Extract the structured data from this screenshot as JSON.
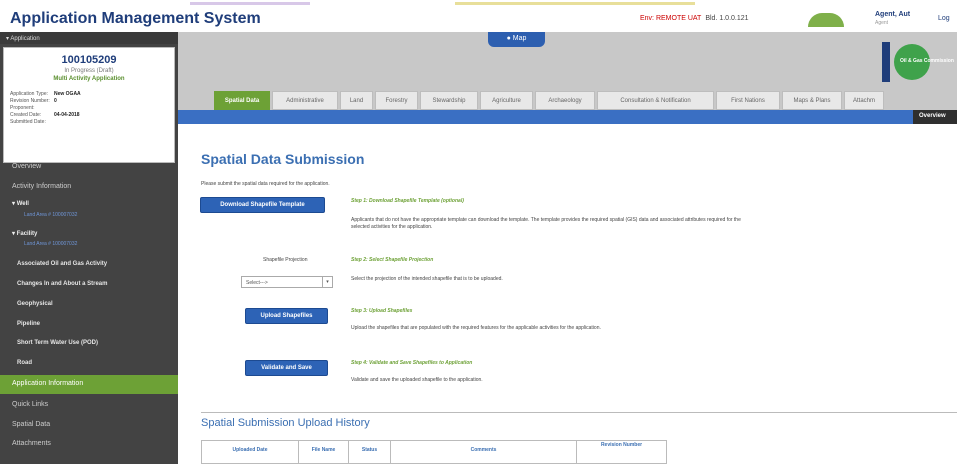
{
  "header": {
    "app_title": "Application Management System",
    "env_label": "Env: REMOTE UAT",
    "env_version": "Bld. 1.0.0.121",
    "agent_name": "Agent, Aut",
    "agent_sub": "Agent",
    "logout_label": "Log"
  },
  "sidebar": {
    "section_label": "Application",
    "app_number": "100105209",
    "app_status": "In Progress (Draft)",
    "app_type_label": "Multi Activity Application",
    "details": [
      {
        "key": "Application Type:",
        "value": "New OGAA"
      },
      {
        "key": "Revision Number:",
        "value": "0"
      },
      {
        "key": "Proponent:",
        "value": ""
      },
      {
        "key": "Created Date:",
        "value": "04-04-2018"
      },
      {
        "key": "Submitted Date:",
        "value": ""
      }
    ],
    "overview": "Overview",
    "activity_information": "Activity Information",
    "well_group": "Well",
    "well_land": "Land Area # 100007032",
    "facility_group": "Facility",
    "facility_land": "Land Area # 100007032",
    "items": [
      "Associated Oil and Gas Activity",
      "Changes In and About a Stream",
      "Geophysical",
      "Pipeline",
      "Short Term Water Use (POD)",
      "Road"
    ],
    "application_information": "Application Information",
    "quick_links": "Quick Links",
    "spatial_data": "Spatial Data",
    "attachments": "Attachments"
  },
  "map_button": "Map",
  "tabs": [
    {
      "label": "Spatial Data",
      "active": true
    },
    {
      "label": "Administrative",
      "active": false
    },
    {
      "label": "Land",
      "active": false
    },
    {
      "label": "Forestry",
      "active": false
    },
    {
      "label": "Stewardship",
      "active": false
    },
    {
      "label": "Agriculture",
      "active": false
    },
    {
      "label": "Archaeology",
      "active": false
    },
    {
      "label": "Consultation & Notification",
      "active": false
    },
    {
      "label": "First Nations",
      "active": false
    },
    {
      "label": "Maps & Plans",
      "active": false
    },
    {
      "label": "Attachm",
      "active": false
    }
  ],
  "overview_button": "Overview",
  "logo_text": "Oil & Gas Commission",
  "main": {
    "page_title": "Spatial Data Submission",
    "intro": "Please submit the spatial data required for the application.",
    "step1": {
      "button": "Download Shapefile Template",
      "title": "Step 1: Download Shapefile Template (optional)",
      "desc": "Applicants that do not have the appropriate template can download the template. The template provides the required spatial (GIS) data and associated attributes required for the selected activities for the application."
    },
    "step2": {
      "label": "Shapefile Projection",
      "select_value": "Select--->",
      "title": "Step 2: Select Shapefile Projection",
      "desc": "Select the projection of the intended shapefile that is to be uploaded."
    },
    "step3": {
      "button": "Upload Shapefiles",
      "title": "Step 3: Upload Shapefiles",
      "desc": "Upload the shapefiles that are populated with the required features for the applicable activities for the application."
    },
    "step4": {
      "button": "Validate and Save",
      "title": "Step 4: Validate and Save Shapefiles to Application",
      "desc": "Validate and save the uploaded shapefile to the application."
    },
    "history_title": "Spatial Submission Upload History",
    "history_columns": [
      "Uploaded Date",
      "File Name",
      "Status",
      "Comments",
      "Revision Number"
    ]
  }
}
